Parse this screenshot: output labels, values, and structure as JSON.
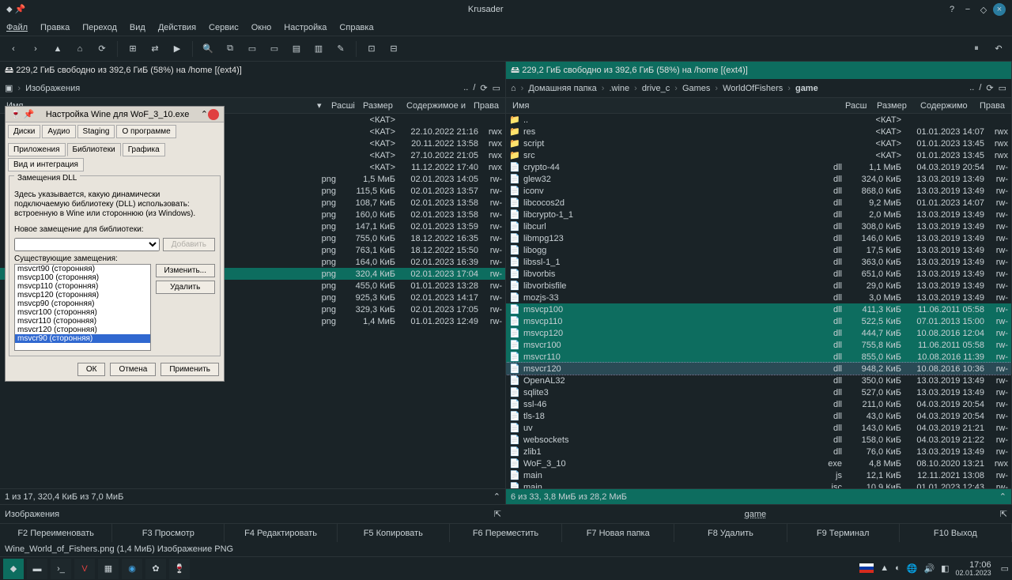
{
  "window": {
    "title": "Krusader"
  },
  "menu": [
    "Файл",
    "Правка",
    "Переход",
    "Вид",
    "Действия",
    "Сервис",
    "Окно",
    "Настройка",
    "Справка"
  ],
  "diskinfo": "229,2 ГиБ свободно из 392,6 ГиБ (58%) на /home [(ext4)]",
  "left": {
    "breadcrumb": [
      "Изображения"
    ],
    "columns": {
      "name": "Имя",
      "ext": "Расшi",
      "size": "Размер",
      "content": "Содержимое и",
      "perm": "Права"
    },
    "status": "1 из 17, 320,4 КиБ из 7,0 МиБ",
    "cmdlabel": "Изображения"
  },
  "right": {
    "breadcrumb": [
      "Домашняя папка",
      ".wine",
      "drive_c",
      "Games",
      "WorldOfFishers",
      "game"
    ],
    "columns": {
      "name": "Имя",
      "ext": "Расш",
      "size": "Размер",
      "content": "Содержимо",
      "perm": "Права"
    },
    "files": [
      {
        "n": "..",
        "e": "",
        "s": "<КАТ>",
        "d": "",
        "p": ""
      },
      {
        "n": "res",
        "e": "",
        "s": "<КАТ>",
        "d": "01.01.2023 14:07",
        "p": "rwx"
      },
      {
        "n": "script",
        "e": "",
        "s": "<КАТ>",
        "d": "01.01.2023 13:45",
        "p": "rwx"
      },
      {
        "n": "src",
        "e": "",
        "s": "<КАТ>",
        "d": "01.01.2023 13:45",
        "p": "rwx"
      },
      {
        "n": "crypto-44",
        "e": "dll",
        "s": "1,1 МиБ",
        "d": "04.03.2019 20:54",
        "p": "rw-"
      },
      {
        "n": "glew32",
        "e": "dll",
        "s": "324,0 КиБ",
        "d": "13.03.2019 13:49",
        "p": "rw-"
      },
      {
        "n": "iconv",
        "e": "dll",
        "s": "868,0 КиБ",
        "d": "13.03.2019 13:49",
        "p": "rw-"
      },
      {
        "n": "libcocos2d",
        "e": "dll",
        "s": "9,2 МиБ",
        "d": "01.01.2023 14:07",
        "p": "rw-"
      },
      {
        "n": "libcrypto-1_1",
        "e": "dll",
        "s": "2,0 МиБ",
        "d": "13.03.2019 13:49",
        "p": "rw-"
      },
      {
        "n": "libcurl",
        "e": "dll",
        "s": "308,0 КиБ",
        "d": "13.03.2019 13:49",
        "p": "rw-"
      },
      {
        "n": "libmpg123",
        "e": "dll",
        "s": "146,0 КиБ",
        "d": "13.03.2019 13:49",
        "p": "rw-"
      },
      {
        "n": "libogg",
        "e": "dll",
        "s": "17,5 КиБ",
        "d": "13.03.2019 13:49",
        "p": "rw-"
      },
      {
        "n": "libssl-1_1",
        "e": "dll",
        "s": "363,0 КиБ",
        "d": "13.03.2019 13:49",
        "p": "rw-"
      },
      {
        "n": "libvorbis",
        "e": "dll",
        "s": "651,0 КиБ",
        "d": "13.03.2019 13:49",
        "p": "rw-"
      },
      {
        "n": "libvorbisfile",
        "e": "dll",
        "s": "29,0 КиБ",
        "d": "13.03.2019 13:49",
        "p": "rw-"
      },
      {
        "n": "mozjs-33",
        "e": "dll",
        "s": "3,0 МиБ",
        "d": "13.03.2019 13:49",
        "p": "rw-"
      },
      {
        "n": "msvcp100",
        "e": "dll",
        "s": "411,3 КиБ",
        "d": "11.06.2011 05:58",
        "p": "rw-",
        "sel": true
      },
      {
        "n": "msvcp110",
        "e": "dll",
        "s": "522,5 КиБ",
        "d": "07.01.2013 15:00",
        "p": "rw-",
        "sel": true
      },
      {
        "n": "msvcp120",
        "e": "dll",
        "s": "444,7 КиБ",
        "d": "10.08.2016 12:04",
        "p": "rw-",
        "sel": true
      },
      {
        "n": "msvcr100",
        "e": "dll",
        "s": "755,8 КиБ",
        "d": "11.06.2011 05:58",
        "p": "rw-",
        "sel": true
      },
      {
        "n": "msvcr110",
        "e": "dll",
        "s": "855,0 КиБ",
        "d": "10.08.2016 11:39",
        "p": "rw-",
        "sel": true
      },
      {
        "n": "msvcr120",
        "e": "dll",
        "s": "948,2 КиБ",
        "d": "10.08.2016 10:36",
        "p": "rw-",
        "sel": true,
        "cur": true
      },
      {
        "n": "OpenAL32",
        "e": "dll",
        "s": "350,0 КиБ",
        "d": "13.03.2019 13:49",
        "p": "rw-"
      },
      {
        "n": "sqlite3",
        "e": "dll",
        "s": "527,0 КиБ",
        "d": "13.03.2019 13:49",
        "p": "rw-"
      },
      {
        "n": "ssl-46",
        "e": "dll",
        "s": "211,0 КиБ",
        "d": "04.03.2019 20:54",
        "p": "rw-"
      },
      {
        "n": "tls-18",
        "e": "dll",
        "s": "43,0 КиБ",
        "d": "04.03.2019 20:54",
        "p": "rw-"
      },
      {
        "n": "uv",
        "e": "dll",
        "s": "143,0 КиБ",
        "d": "04.03.2019 21:21",
        "p": "rw-"
      },
      {
        "n": "websockets",
        "e": "dll",
        "s": "158,0 КиБ",
        "d": "04.03.2019 21:22",
        "p": "rw-"
      },
      {
        "n": "zlib1",
        "e": "dll",
        "s": "76,0 КиБ",
        "d": "13.03.2019 13:49",
        "p": "rw-"
      },
      {
        "n": "WoF_3_10",
        "e": "exe",
        "s": "4,8 МиБ",
        "d": "08.10.2020 13:21",
        "p": "rwx"
      },
      {
        "n": "main",
        "e": "js",
        "s": "12,1 КиБ",
        "d": "12.11.2021 13:08",
        "p": "rw-"
      },
      {
        "n": "main",
        "e": "jsc",
        "s": "10,9 КиБ",
        "d": "01.01.2023 12:43",
        "p": "rw-"
      }
    ],
    "left_files": [
      {
        "n": "..",
        "e": "",
        "s": "<КАТ>",
        "d": "",
        "p": ""
      },
      {
        "n": "",
        "e": "",
        "s": "<КАТ>",
        "d": "22.10.2022 21:16",
        "p": "rwx"
      },
      {
        "n": "",
        "e": "",
        "s": "<КАТ>",
        "d": "20.11.2022 13:58",
        "p": "rwx"
      },
      {
        "n": "",
        "e": "",
        "s": "<КАТ>",
        "d": "27.10.2022 21:05",
        "p": "rwx"
      },
      {
        "n": "",
        "e": "",
        "s": "<КАТ>",
        "d": "11.12.2022 17:40",
        "p": "rwx"
      },
      {
        "n": "",
        "e": "png",
        "s": "1,5 МиБ",
        "d": "02.01.2023 14:05",
        "p": "rw-"
      },
      {
        "n": "",
        "e": "png",
        "s": "115,5 КиБ",
        "d": "02.01.2023 13:57",
        "p": "rw-"
      },
      {
        "n": "",
        "e": "png",
        "s": "108,7 КиБ",
        "d": "02.01.2023 13:58",
        "p": "rw-"
      },
      {
        "n": "",
        "e": "png",
        "s": "160,0 КиБ",
        "d": "02.01.2023 13:58",
        "p": "rw-"
      },
      {
        "n": "",
        "e": "png",
        "s": "147,1 КиБ",
        "d": "02.01.2023 13:59",
        "p": "rw-"
      },
      {
        "n": "",
        "e": "png",
        "s": "755,0 КиБ",
        "d": "18.12.2022 16:35",
        "p": "rw-"
      },
      {
        "n": "",
        "e": "png",
        "s": "763,1 КиБ",
        "d": "18.12.2022 15:50",
        "p": "rw-"
      },
      {
        "n": "",
        "e": "png",
        "s": "164,0 КиБ",
        "d": "02.01.2023 16:39",
        "p": "rw-"
      },
      {
        "n": "",
        "e": "png",
        "s": "320,4 КиБ",
        "d": "02.01.2023 17:04",
        "p": "rw-",
        "sel": true
      },
      {
        "n": "",
        "e": "png",
        "s": "455,0 КиБ",
        "d": "01.01.2023 13:28",
        "p": "rw-"
      },
      {
        "n": "",
        "e": "png",
        "s": "925,3 КиБ",
        "d": "02.01.2023 14:17",
        "p": "rw-"
      },
      {
        "n": "",
        "e": "png",
        "s": "329,3 КиБ",
        "d": "02.01.2023 17:05",
        "p": "rw-"
      },
      {
        "n": "",
        "e": "png",
        "s": "1,4 МиБ",
        "d": "01.01.2023 12:49",
        "p": "rw-"
      }
    ],
    "status": "6 из 33, 3,8 МиБ из 28,2 МиБ",
    "cmdlabel": "game"
  },
  "fkeys": [
    "F2 Переименовать",
    "F3 Просмотр",
    "F4 Редактировать",
    "F5 Копировать",
    "F6 Переместить",
    "F7 Новая папка",
    "F8 Удалить",
    "F9 Терминал",
    "F10 Выход"
  ],
  "hint": "Wine_World_of_Fishers.png  (1,4 МиБ)  Изображение PNG",
  "clock": {
    "time": "17:06",
    "date": "02.01.2023"
  },
  "dialog": {
    "title": "Настройка Wine для WoF_3_10.exe",
    "tabs_top": [
      "Диски",
      "Аудио",
      "Staging",
      "О программе"
    ],
    "tabs_bot": [
      "Приложения",
      "Библиотеки",
      "Графика",
      "Вид и интеграция"
    ],
    "group": "Замещения DLL",
    "desc": "Здесь указывается, какую динамически подключаемую библиотеку (DLL) использовать: встроенную в Wine или стороннюю (из Windows).",
    "newlabel": "Новое замещение для библиотеки:",
    "existlabel": "Существующие замещения:",
    "add": "Добавить",
    "edit": "Изменить...",
    "delete": "Удалить",
    "list": [
      "msvcrt90 (сторонняя)",
      "msvcp100 (сторонняя)",
      "msvcp110 (сторонняя)",
      "msvcp120 (сторонняя)",
      "msvcp90 (сторонняя)",
      "msvcr100 (сторонняя)",
      "msvcr110 (сторонняя)",
      "msvcr120 (сторонняя)",
      "msvcr90 (сторонняя)"
    ],
    "ok": "ОК",
    "cancel": "Отмена",
    "apply": "Применить"
  }
}
